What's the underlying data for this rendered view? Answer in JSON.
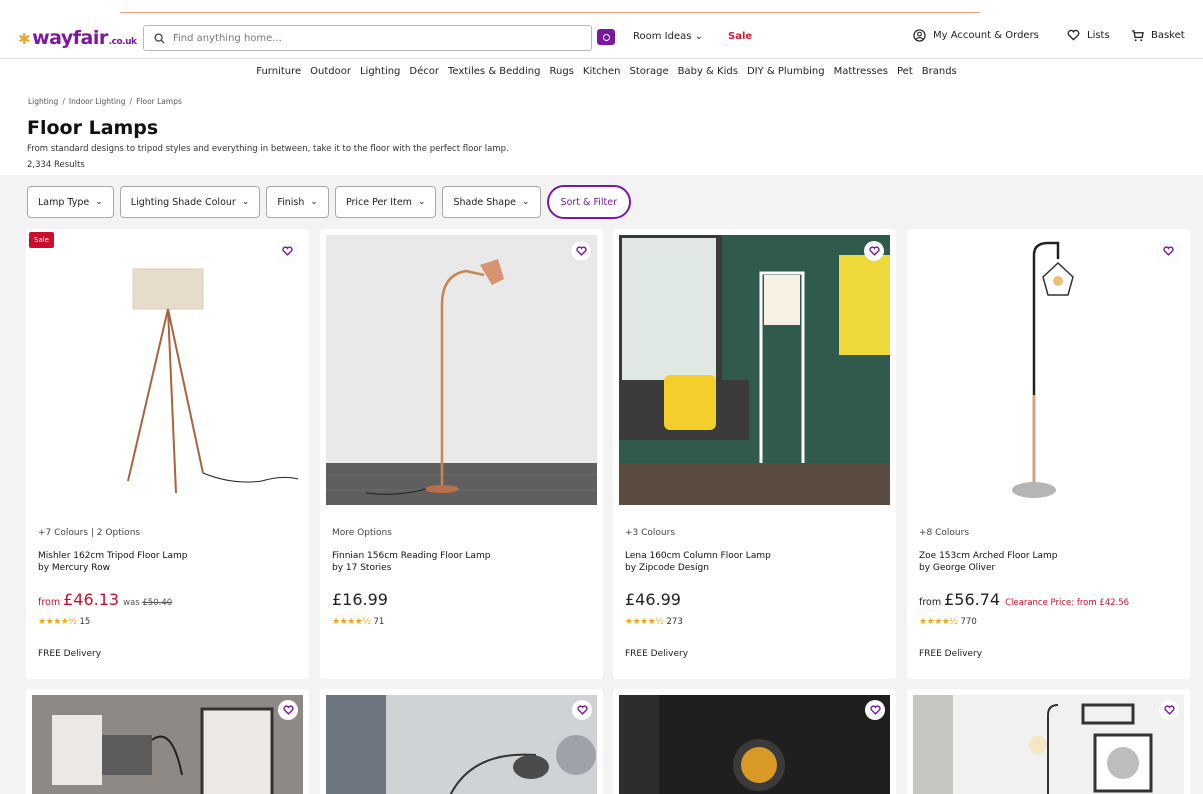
{
  "header": {
    "logo_text": "wayfair",
    "logo_tld": ".co.uk",
    "search_placeholder": "Find anything home...",
    "room_ideas_label": "Room Ideas",
    "sale_label": "Sale",
    "account_label": "My Account & Orders",
    "lists_label": "Lists",
    "basket_label": "Basket"
  },
  "category_nav": [
    "Furniture",
    "Outdoor",
    "Lighting",
    "Décor",
    "Textiles & Bedding",
    "Rugs",
    "Kitchen",
    "Storage",
    "Baby & Kids",
    "DIY & Plumbing",
    "Mattresses",
    "Pet",
    "Brands"
  ],
  "breadcrumb": [
    "Lighting",
    "/",
    "Indoor Lighting",
    "/",
    "Floor Lamps"
  ],
  "page": {
    "title": "Floor Lamps",
    "subtitle": "From standard designs to tripod styles and everything in between, take it to the floor with the perfect floor lamp.",
    "results": "2,334 Results"
  },
  "filters": [
    "Lamp Type",
    "Lighting Shade Colour",
    "Finish",
    "Price Per Item",
    "Shade Shape"
  ],
  "sort_filter_label": "Sort & Filter",
  "products": [
    {
      "badge": "Sale",
      "options": "+7 Colours | 2 Options",
      "name": "Mishler 162cm Tripod Floor Lamp",
      "brand": "by Mercury Row",
      "from": "from",
      "price": "£46.13",
      "was_label": "was",
      "was_price": "£50.40",
      "stars": "★★★★½",
      "reviews": "15",
      "delivery": "FREE Delivery"
    },
    {
      "options": "More Options",
      "name": "Finnian 156cm Reading Floor Lamp",
      "brand": "by 17 Stories",
      "price": "£16.99",
      "stars": "★★★★½",
      "reviews": "71"
    },
    {
      "options": "+3 Colours",
      "name": "Lena 160cm Column Floor Lamp",
      "brand": "by Zipcode Design",
      "price": "£46.99",
      "stars": "★★★★½",
      "reviews": "273",
      "delivery": "FREE Delivery"
    },
    {
      "options": "+8 Colours",
      "name": "Zoe 153cm Arched Floor Lamp",
      "brand": "by George Oliver",
      "from": "from",
      "price": "£56.74",
      "clearance": "Clearance Price: from £42.56",
      "stars": "★★★★½",
      "reviews": "770",
      "delivery": "FREE Delivery"
    }
  ],
  "colors": {
    "brand_purple": "#7b189f",
    "sale_red": "#c8102e",
    "star_gold": "#f0a614"
  }
}
